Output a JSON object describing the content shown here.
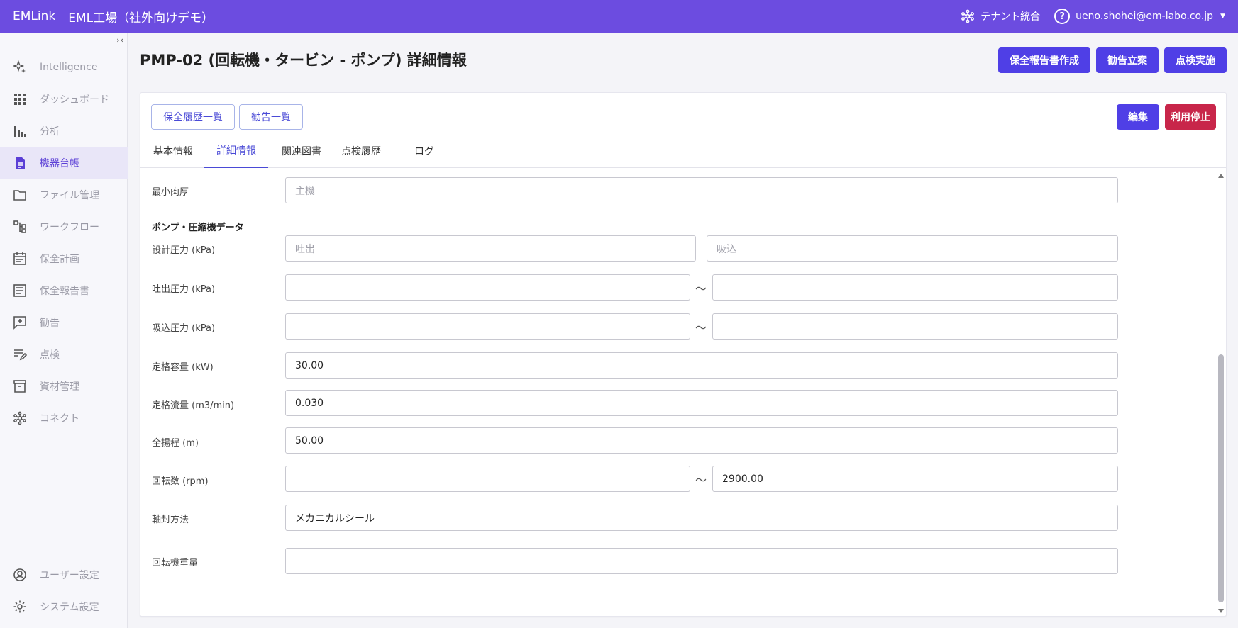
{
  "header": {
    "brand": "EMLink",
    "site": "EML工場（社外向けデモ）",
    "tenant": "テナント統合",
    "user": "ueno.shohei@em-labo.co.jp"
  },
  "sidebar": {
    "items": [
      {
        "label": "Intelligence",
        "icon": "sparkle-icon"
      },
      {
        "label": "ダッシュボード",
        "icon": "grid-icon"
      },
      {
        "label": "分析",
        "icon": "bar-chart-icon"
      },
      {
        "label": "機器台帳",
        "icon": "document-icon"
      },
      {
        "label": "ファイル管理",
        "icon": "folder-icon"
      },
      {
        "label": "ワークフロー",
        "icon": "workflow-icon"
      },
      {
        "label": "保全計画",
        "icon": "calendar-icon"
      },
      {
        "label": "保全報告書",
        "icon": "report-icon"
      },
      {
        "label": "勧告",
        "icon": "comment-plus-icon"
      },
      {
        "label": "点検",
        "icon": "edit-list-icon"
      },
      {
        "label": "資材管理",
        "icon": "archive-icon"
      },
      {
        "label": "コネクト",
        "icon": "network-icon"
      }
    ],
    "bottom": [
      {
        "label": "ユーザー設定",
        "icon": "user-circle-icon"
      },
      {
        "label": "システム設定",
        "icon": "gear-icon"
      }
    ],
    "active": "機器台帳",
    "accent": "#5b3fd6"
  },
  "page": {
    "title": "PMP-02 (回転機・タービン - ポンプ) 詳細情報",
    "actions": {
      "report": "保全報告書作成",
      "advice": "勧告立案",
      "inspect": "点検実施"
    }
  },
  "card": {
    "history_button": "保全履歴一覧",
    "advice_list_button": "勧告一覧",
    "edit_button": "編集",
    "disable_button": "利用停止",
    "tabs": [
      "基本情報",
      "詳細情報",
      "関連図書",
      "点検履歴",
      "ログ"
    ],
    "active_tab": "詳細情報"
  },
  "form": {
    "min_thickness": {
      "label": "最小肉厚",
      "placeholder": "主機",
      "value": ""
    },
    "section_title": "ポンプ・圧縮機データ",
    "design_pressure": {
      "label": "設計圧力 (kPa)",
      "discharge_placeholder": "吐出",
      "suction_placeholder": "吸込"
    },
    "discharge_pressure": {
      "label": "吐出圧力 (kPa)",
      "from": "",
      "to": ""
    },
    "suction_pressure": {
      "label": "吸込圧力 (kPa)",
      "from": "",
      "to": ""
    },
    "rated_capacity": {
      "label": "定格容量 (kW)",
      "value": "30.00"
    },
    "rated_flow": {
      "label": "定格流量 (m3/min)",
      "value": "0.030"
    },
    "total_head": {
      "label": "全揚程 (m)",
      "value": "50.00"
    },
    "rotation_speed": {
      "label": "回転数 (rpm)",
      "from": "",
      "to": "2900.00"
    },
    "shaft_seal": {
      "label": "軸封方法",
      "value": "メカニカルシール"
    },
    "rotor_weight": {
      "label": "回転機重量",
      "value": ""
    },
    "tilde": "〜"
  }
}
